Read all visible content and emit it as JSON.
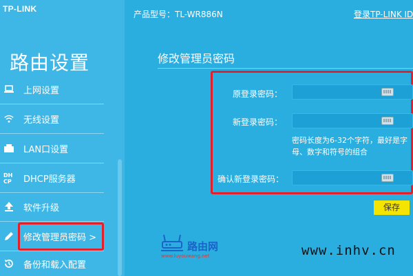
{
  "logo": "TP-LINK",
  "sidebar": {
    "title": "路由设置",
    "items": [
      {
        "label": "上网设置",
        "icon": "laptop-icon"
      },
      {
        "label": "无线设置",
        "icon": "wifi-icon"
      },
      {
        "label": "LAN口设置",
        "icon": "lan-port-icon"
      },
      {
        "label": "DHCP服务器",
        "icon": "dhcp-icon"
      },
      {
        "label": "软件升级",
        "icon": "upgrade-arrow-icon"
      },
      {
        "label": "修改管理员密码 >",
        "icon": "pencil-icon",
        "active": true
      },
      {
        "label": "备份和载入配置",
        "icon": "backup-restore-icon"
      }
    ]
  },
  "header": {
    "model": "产品型号：TL-WR886N",
    "login_link": "登录TP-LINK ID"
  },
  "main": {
    "title": "修改管理员密码",
    "fields": {
      "old_label": "原登录密码：",
      "new_label": "新登录密码：",
      "confirm_label": "确认新登录密码："
    },
    "hint": "密码长度为6-32个字符，最好是字母、数字和符号的组合",
    "save_label": "保存"
  },
  "watermarks": {
    "brand": "路由网",
    "url": "www.luyouwang.net",
    "site": "www.inhv.cn"
  },
  "colors": {
    "background": "#2aaee0",
    "sidebar": "#3fb7e6",
    "highlight_border": "#e0202a",
    "save_button": "#f5e400"
  }
}
